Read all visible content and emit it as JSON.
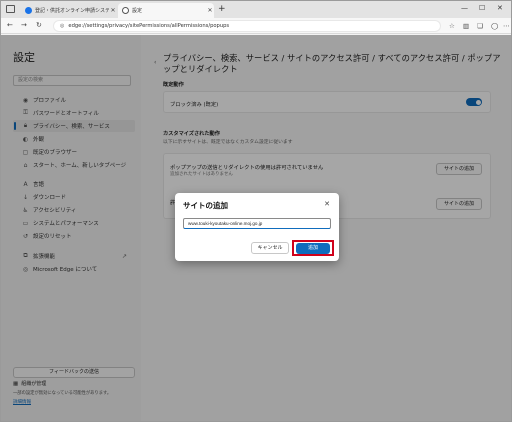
{
  "tabs": [
    {
      "title": "登記・供託オンライン申請システム"
    },
    {
      "title": "設定"
    }
  ],
  "toolbar": {
    "url": "edge://settings/privacy/sitePermissions/allPermissions/popups"
  },
  "sidebar": {
    "title": "設定",
    "search_placeholder": "設定の検索",
    "items": [
      {
        "label": "プロファイル",
        "icon": "profile-icon"
      },
      {
        "label": "パスワードとオートフィル",
        "icon": "key-icon"
      },
      {
        "label": "プライバシー、検索、サービス",
        "icon": "lock-icon",
        "active": true
      },
      {
        "label": "外観",
        "icon": "appearance-icon"
      },
      {
        "label": "既定のブラウザー",
        "icon": "browser-icon"
      },
      {
        "label": "スタート、ホーム、新しいタブページ",
        "icon": "home-icon"
      },
      {
        "label": "言語",
        "icon": "language-icon"
      },
      {
        "label": "ダウンロード",
        "icon": "download-icon"
      },
      {
        "label": "アクセシビリティ",
        "icon": "accessibility-icon"
      },
      {
        "label": "システムとパフォーマンス",
        "icon": "system-icon"
      },
      {
        "label": "設定のリセット",
        "icon": "reset-icon"
      },
      {
        "label": "拡張機能",
        "icon": "extensions-icon"
      },
      {
        "label": "Microsoft Edge について",
        "icon": "edge-icon"
      }
    ],
    "feedback": "フィードバックの送信",
    "managed": "組織が管理",
    "managed_note": "一部の設定が無効になっている可能性があります。",
    "details_link": "詳細情報"
  },
  "main": {
    "title": "プライバシー、検索、サービス / サイトのアクセス許可 / すべてのアクセス許可 / ポップアップとリダイレクト",
    "default_label": "既定動作",
    "blocked_label": "ブロック済み (既定)",
    "custom_label": "カスタマイズされた動作",
    "custom_desc": "以下に示すサイトは、既定ではなくカスタム設定に従います",
    "disallowed_text": "ポップアップの送信とリダイレクトの使用は許可されていません",
    "disallowed_sub": "追加されたサイトはありません",
    "allowed_text": "許",
    "add_site_label": "サイトの追加"
  },
  "dialog": {
    "title": "サイトの追加",
    "input_value": "www.touki-kyoutaku-online.moj.go.jp",
    "cancel": "キャンセル",
    "add": "追加"
  },
  "colors": {
    "accent": "#0f6cbd",
    "highlight": "#d0021b"
  }
}
